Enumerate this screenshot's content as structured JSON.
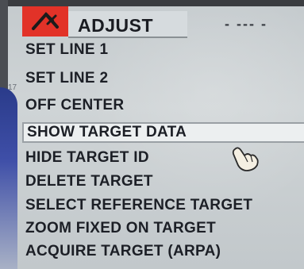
{
  "header": {
    "title": "ADJUST",
    "dashes": "- --- -"
  },
  "side_number": "17",
  "menu": {
    "items": [
      {
        "label": "SET LINE 1"
      },
      {
        "label": "SET LINE 2"
      },
      {
        "label": "OFF CENTER"
      },
      {
        "label": "SHOW TARGET DATA",
        "selected": true
      },
      {
        "label": "HIDE TARGET ID"
      },
      {
        "label": "DELETE TARGET"
      },
      {
        "label": "SELECT REFERENCE TARGET"
      },
      {
        "label": "ZOOM FIXED ON TARGET"
      },
      {
        "label": "ACQUIRE TARGET (ARPA)"
      }
    ]
  },
  "colors": {
    "accent_red": "#e23228",
    "text": "#1c1f26",
    "background": "#c9cfd2"
  },
  "icons": {
    "header": "target-crossed-icon",
    "pointer": "hand-pointer-icon"
  }
}
